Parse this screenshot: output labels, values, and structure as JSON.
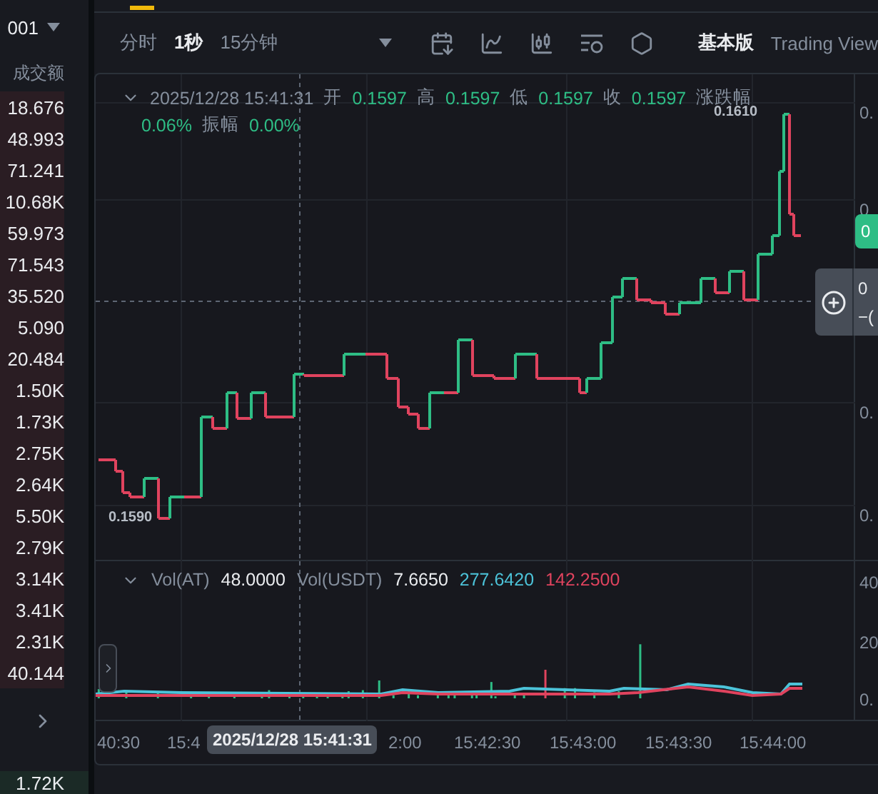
{
  "order_book": {
    "pair_suffix": "001",
    "column_header": "成交额",
    "rows": [
      "18.676",
      "48.993",
      "71.241",
      "10.68K",
      "59.973",
      "71.543",
      "35.520",
      "5.090",
      "20.484",
      "1.50K",
      "1.73K",
      "2.75K",
      "2.64K",
      "5.50K",
      "2.79K",
      "3.14K",
      "3.41K",
      "2.31K",
      "40.144"
    ],
    "last_value": "1.72K"
  },
  "toolbar": {
    "intervals": [
      {
        "label": "分时",
        "selected": false
      },
      {
        "label": "1秒",
        "selected": true
      },
      {
        "label": "15分钟",
        "selected": false
      }
    ],
    "views": [
      {
        "label": "基本版",
        "selected": true
      },
      {
        "label": "Trading View",
        "selected": false
      }
    ]
  },
  "legend": {
    "date": "2025/12/28 15:41:31",
    "fields": [
      {
        "label": "开",
        "value": "0.1597"
      },
      {
        "label": "高",
        "value": "0.1597"
      },
      {
        "label": "低",
        "value": "0.1597"
      },
      {
        "label": "收",
        "value": "0.1597"
      }
    ],
    "change_label": "涨跌幅",
    "change": "0.06%",
    "amplitude_label": "振幅",
    "amplitude": "0.00%"
  },
  "price_labels": {
    "high": "0.1610",
    "low": "0.1590"
  },
  "price_axis": [
    "0.",
    "0",
    "0.",
    "0."
  ],
  "last_price_tag": "0",
  "crosshair_price": [
    "0",
    "−("
  ],
  "volume": {
    "items": [
      {
        "label": "Vol(AT)",
        "value": "48.0000",
        "color": "#eaecef"
      },
      {
        "label": "Vol(USDT)",
        "value": "7.6650",
        "color": "#eaecef"
      },
      {
        "value": "277.6420",
        "color": "#4cc3d9"
      },
      {
        "value": "142.2500",
        "color": "#e0435e"
      }
    ],
    "axis": [
      "40",
      "20",
      "0."
    ]
  },
  "time_axis": {
    "ticks": [
      "40:30",
      "15:4",
      "2:00",
      "15:42:30",
      "15:43:00",
      "15:43:30",
      "15:44:00"
    ],
    "crosshair": "2025/12/28 15:41:31"
  }
}
